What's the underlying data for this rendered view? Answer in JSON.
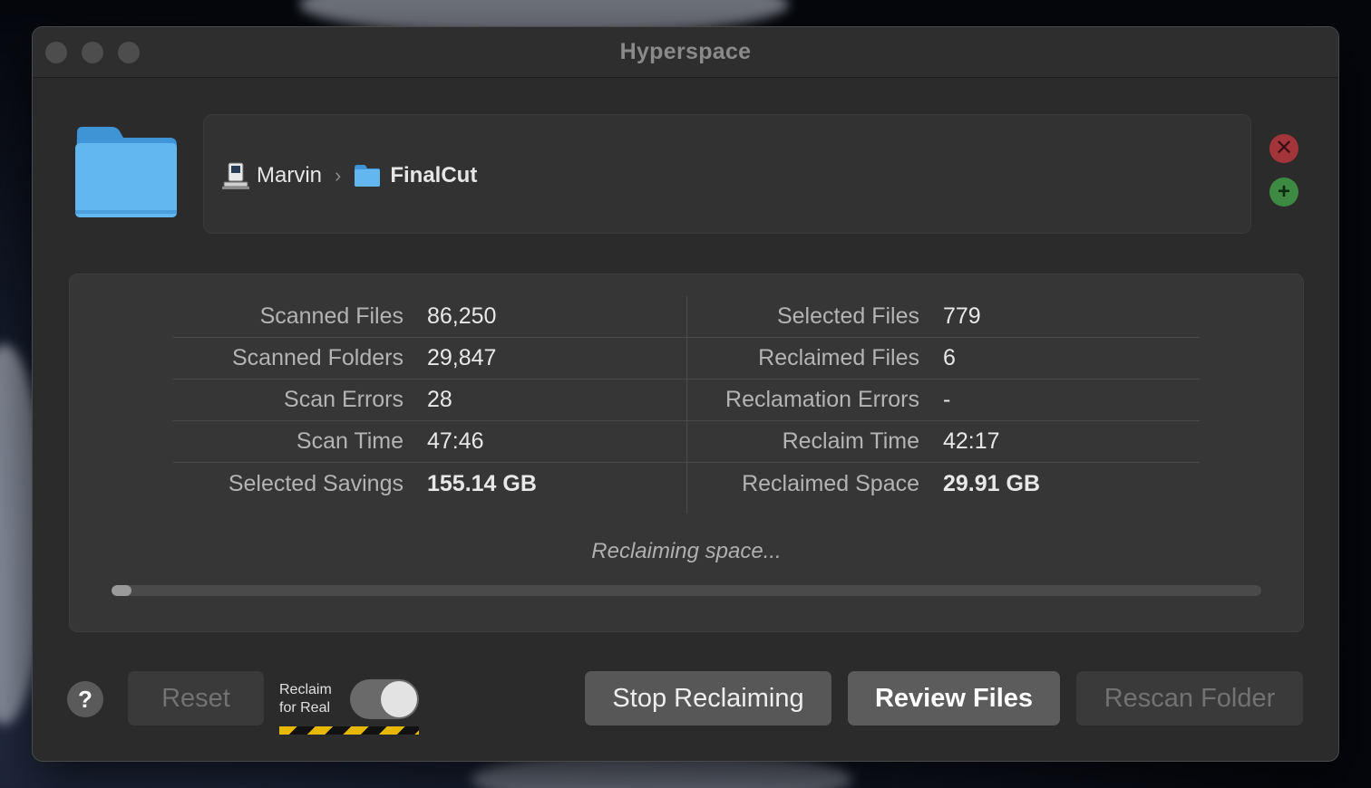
{
  "window": {
    "title": "Hyperspace"
  },
  "path": {
    "segments": [
      {
        "label": "Marvin",
        "icon": "computer-icon"
      },
      {
        "label": "FinalCut",
        "icon": "folder-icon"
      }
    ]
  },
  "stats": {
    "left": [
      {
        "label": "Scanned Files",
        "value": "86,250"
      },
      {
        "label": "Scanned Folders",
        "value": "29,847"
      },
      {
        "label": "Scan Errors",
        "value": "28"
      },
      {
        "label": "Scan Time",
        "value": "47:46"
      },
      {
        "label": "Selected Savings",
        "value": "155.14 GB"
      }
    ],
    "right": [
      {
        "label": "Selected Files",
        "value": "779"
      },
      {
        "label": "Reclaimed Files",
        "value": "6"
      },
      {
        "label": "Reclamation Errors",
        "value": "-"
      },
      {
        "label": "Reclaim Time",
        "value": "42:17"
      },
      {
        "label": "Reclaimed Space",
        "value": "29.91 GB"
      }
    ]
  },
  "status": {
    "text": "Reclaiming space...",
    "progress": 0.017
  },
  "toolbar": {
    "help_label": "?",
    "reset_label": "Reset",
    "reclaim_toggle_label": "Reclaim for Real",
    "reclaim_toggle_on": true,
    "stop_label": "Stop Reclaiming",
    "review_label": "Review Files",
    "rescan_label": "Rescan Folder"
  },
  "colors": {
    "remove": "#a3343a",
    "add": "#3f8a42",
    "folder": "#5eb4f0",
    "hazard": "#e6b800"
  }
}
